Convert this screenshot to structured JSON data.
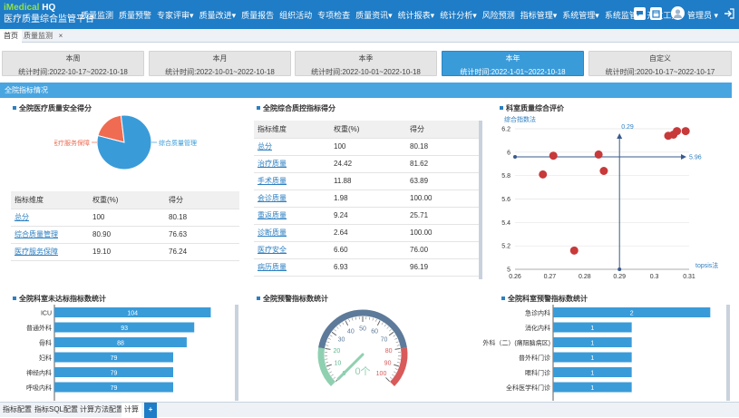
{
  "app": {
    "brand": "iMedical",
    "brand_suffix": "HQ",
    "title": "医疗质量综合监管平台"
  },
  "nav": [
    "质量监测",
    "质量预警",
    "专家评审▾",
    "质量改进▾",
    "质量报告",
    "组织活动",
    "专项检查",
    "质量资讯▾",
    "统计报表▾",
    "统计分析▾",
    "风险预测",
    "指标管理▾",
    "系统管理▾",
    "系统监管▾",
    "开发工具▾"
  ],
  "user": {
    "name": "管理员"
  },
  "tabs": {
    "home": "首页",
    "active": "质量监测",
    "close": "×"
  },
  "periods": [
    {
      "label": "本周",
      "range": "统计时间:2022-10-17~2022-10-18"
    },
    {
      "label": "本月",
      "range": "统计时间:2022-10-01~2022-10-18"
    },
    {
      "label": "本季",
      "range": "统计时间:2022-10-01~2022-10-18"
    },
    {
      "label": "本年",
      "range": "统计时间:2022-1-01~2022-10-18"
    },
    {
      "label": "自定义",
      "range": "统计时间:2020-10-17~2022-10-17"
    }
  ],
  "section_title": "全院指标情况",
  "panel1": {
    "title": "全院医疗质量安全得分",
    "pie_left_label": "医疗服务保障",
    "pie_right_label": "综合质量管理",
    "headers": [
      "指标维度",
      "权重(%)",
      "得分"
    ],
    "rows": [
      [
        "总分",
        "100",
        "80.18"
      ],
      [
        "综合质量管理",
        "80.90",
        "76.63"
      ],
      [
        "医疗服务保障",
        "19.10",
        "76.24"
      ]
    ]
  },
  "panel2": {
    "title": "全院综合质控指标得分",
    "headers": [
      "指标维度",
      "权重(%)",
      "得分"
    ],
    "rows": [
      [
        "总分",
        "100",
        "80.18"
      ],
      [
        "治疗质量",
        "24.42",
        "81.62"
      ],
      [
        "手术质量",
        "11.88",
        "63.89"
      ],
      [
        "会诊质量",
        "1.98",
        "100.00"
      ],
      [
        "重返质量",
        "9.24",
        "25.71"
      ],
      [
        "诊断质量",
        "2.64",
        "100.00"
      ],
      [
        "医疗安全",
        "6.60",
        "76.00"
      ],
      [
        "病历质量",
        "6.93",
        "96.19"
      ]
    ]
  },
  "panel3": {
    "title": "科室质量综合评价",
    "ylabel": "综合指数法",
    "xlabel": "topsis法",
    "ref_x_label": "0.29",
    "ref_y_label": "5.96"
  },
  "panel4": {
    "title": "全院科室未达标指标数统计"
  },
  "panel5": {
    "title": "全院预警指标数统计",
    "gauge_ticks": [
      "0",
      "10",
      "20",
      "30",
      "40",
      "50",
      "60",
      "70",
      "80",
      "90",
      "100"
    ],
    "gauge_value_text": "0个"
  },
  "panel6": {
    "title": "全院科室预警指标数统计"
  },
  "chart_data": [
    {
      "type": "pie",
      "categories": [
        "医疗服务保障",
        "综合质量管理"
      ],
      "values": [
        19.1,
        80.9
      ]
    },
    {
      "type": "scatter",
      "xlim": [
        0.26,
        0.31
      ],
      "ylim": [
        5,
        6.2
      ],
      "xticks": [
        "0.26",
        "0.27",
        "0.28",
        "0.29",
        "0.3",
        "0.31"
      ],
      "yticks": [
        "5",
        "5.2",
        "5.4",
        "5.6",
        "5.8",
        "6",
        "6.2"
      ],
      "reference_lines": {
        "x": 0.29,
        "y": 5.96
      },
      "points": [
        [
          0.268,
          5.81
        ],
        [
          0.271,
          5.97
        ],
        [
          0.277,
          5.16
        ],
        [
          0.284,
          5.98
        ],
        [
          0.2855,
          5.84
        ],
        [
          0.304,
          6.14
        ],
        [
          0.3055,
          6.15
        ],
        [
          0.3065,
          6.18
        ],
        [
          0.309,
          6.18
        ]
      ],
      "xlabel": "topsis法",
      "ylabel": "综合指数法"
    },
    {
      "type": "bar",
      "orientation": "horizontal",
      "categories": [
        "ICU",
        "普通外科",
        "骨科",
        "妇科",
        "神经内科",
        "呼吸内科"
      ],
      "values": [
        104,
        93,
        88,
        79,
        79,
        79
      ],
      "xlim": [
        0,
        120
      ],
      "color": "#3a9bd9"
    },
    {
      "type": "gauge",
      "range": [
        0,
        100
      ],
      "value": 0,
      "unit": "个"
    },
    {
      "type": "bar",
      "orientation": "horizontal",
      "categories": [
        "急诊内科",
        "消化内科",
        "外科（二）(痛阻脑病区)",
        "普外科门诊",
        "眼科门诊",
        "全科医学科门诊"
      ],
      "values": [
        2,
        1,
        1,
        1,
        1,
        1
      ],
      "xlim": [
        0,
        2.1
      ],
      "color": "#3a9bd9"
    }
  ],
  "bottom_tabs": [
    "指标配置",
    "指标SQL配置",
    "计算方法配置",
    "计算"
  ],
  "bottom_add": "+",
  "colors": {
    "primary": "#1f7cc6",
    "accent": "#3a9bd9",
    "pie_a": "#ef6b51",
    "pie_b": "#3a9bd9",
    "scatter": "#c8393a"
  }
}
